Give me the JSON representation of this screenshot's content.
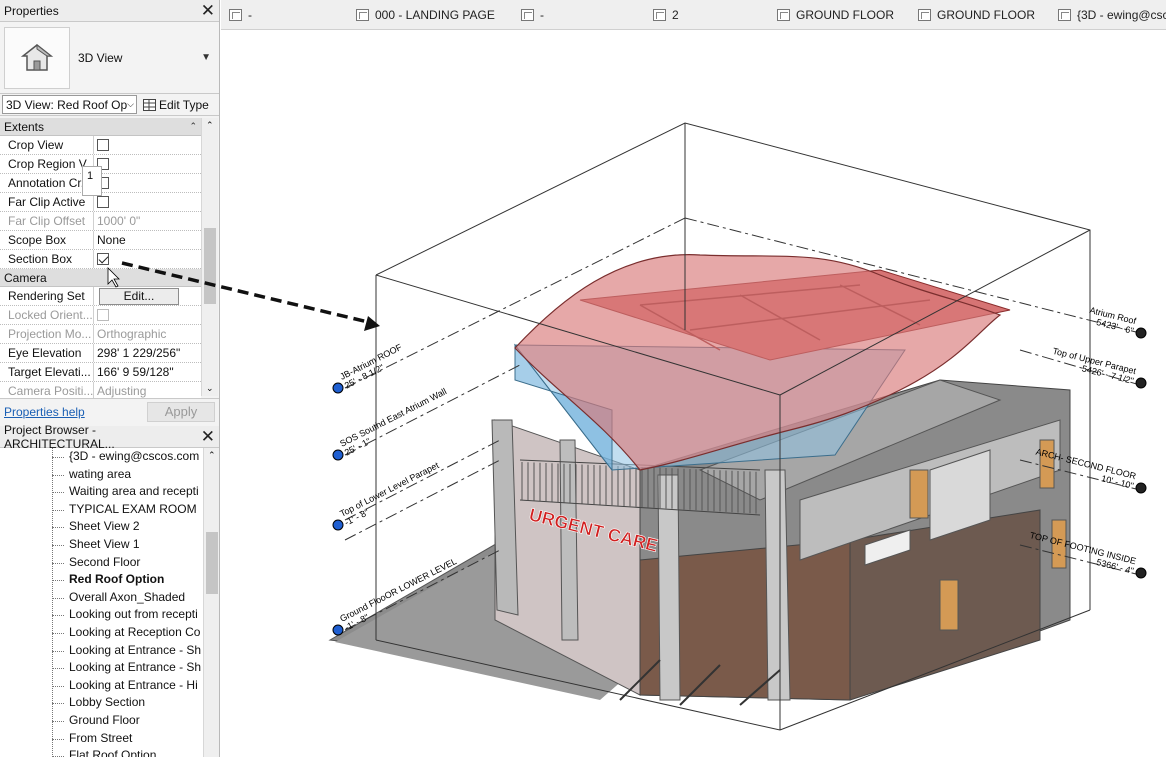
{
  "properties": {
    "title": "Properties",
    "type_name": "3D View",
    "view_selector": "3D View: Red Roof Op",
    "edit_type": "Edit Type",
    "groups": {
      "extents": "Extents",
      "camera": "Camera"
    },
    "extents_rows": [
      {
        "name": "Crop View",
        "value": "",
        "checkbox": "unchecked"
      },
      {
        "name": "Crop Region V...",
        "value": "",
        "checkbox": "unchecked"
      },
      {
        "name": "Annotation Cr...",
        "value": "",
        "checkbox": "unchecked"
      },
      {
        "name": "Far Clip Active",
        "value": "",
        "checkbox": "unchecked"
      },
      {
        "name": "Far Clip Offset",
        "value": "1000'  0\"",
        "disabled": true
      },
      {
        "name": "Scope Box",
        "value": "None"
      },
      {
        "name": "Section Box",
        "value": "",
        "checkbox": "checked"
      }
    ],
    "camera_rows": [
      {
        "name": "Rendering Set",
        "value": "Edit..."
      },
      {
        "name": "Locked Orient...",
        "value": "",
        "disabled": true
      },
      {
        "name": "Projection Mo...",
        "value": "Orthographic",
        "disabled": true
      },
      {
        "name": "Eye Elevation",
        "value": "298'  1 229/256\""
      },
      {
        "name": "Target Elevati...",
        "value": "166'  9 59/128\""
      },
      {
        "name": "Camera Positi...",
        "value": "Adjusting",
        "disabled": true
      }
    ],
    "tooltip": "1",
    "help_link": "Properties help",
    "apply": "Apply"
  },
  "project_browser": {
    "title": "Project Browser - ARCHITECTURAL...",
    "items": [
      "{3D - ewing@cscos.com",
      "wating area",
      "Waiting area and recepti",
      "TYPICAL EXAM ROOM",
      "Sheet View 2",
      "Sheet View 1",
      "Second Floor",
      "Red Roof Option",
      "Overall Axon_Shaded",
      "Looking out from recepti",
      "Looking at Reception Co",
      "Looking at Entrance - Sh",
      "Looking at Entrance - Sh",
      "Looking at Entrance - Hi",
      "Lobby Section",
      "Ground Floor",
      "From Street",
      "Flat Roof Option"
    ],
    "active_index": 7
  },
  "tabs": [
    {
      "label": "-",
      "icon": "sheet-icon"
    },
    {
      "label": "000 - LANDING PAGE",
      "icon": "sheet-icon"
    },
    {
      "label": "-",
      "icon": "sheet-icon"
    },
    {
      "label": "2",
      "icon": "sheet-icon"
    },
    {
      "label": "GROUND FLOOR",
      "icon": "floor-plan-icon"
    },
    {
      "label": "GROUND FLOOR",
      "icon": "floor-plan-icon"
    },
    {
      "label": "{3D - ewing@csc",
      "icon": "3d-view-icon"
    }
  ],
  "model": {
    "sign_text": "URGENT CARE",
    "roof_color": "#d87a7a",
    "glass_color": "#8fc3e3",
    "left_levels": [
      {
        "name": "JB-Atrium ROOF",
        "elev": "25' - 8 1/2\""
      },
      {
        "name": "SOS Southd East Atrium Wall",
        "elev": "25' - 1\""
      },
      {
        "name": "Top of Lower Level Parapet",
        "elev": "-1' - 8\""
      },
      {
        "name": "Ground FlooOR  LOWER LEVEL",
        "elev": "-1' - 8\""
      }
    ],
    "right_levels": [
      {
        "name": "Atrium Roof",
        "elev": "5423' - 6\""
      },
      {
        "name": "Top of Upper Parapet",
        "elev": "5426' - 7 1/2\""
      },
      {
        "name": "ARCH- SECOND FLOOR",
        "elev": "10' - 10\""
      },
      {
        "name": "TOP OF FOOTING INSIDE",
        "elev": "5366' - 4\""
      }
    ]
  }
}
